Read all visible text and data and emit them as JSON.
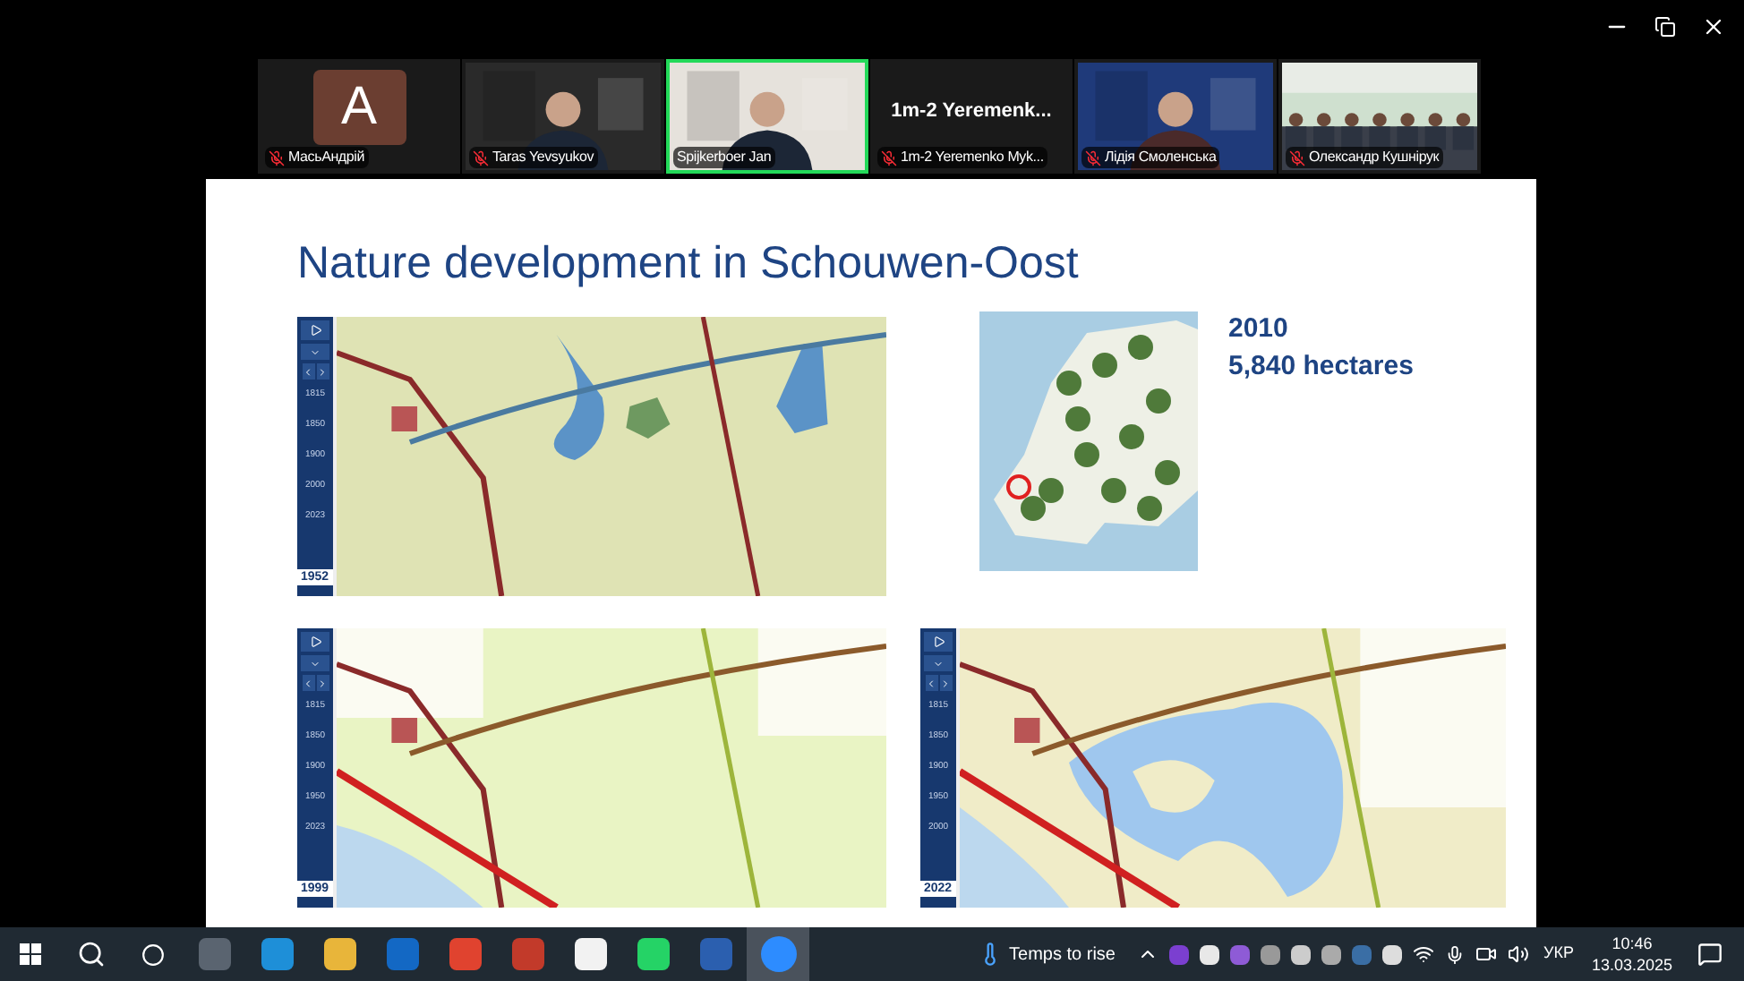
{
  "participants": [
    {
      "kind": "avatar",
      "initial": "A",
      "name": "МасьАндрій",
      "muted": true,
      "speaking": false
    },
    {
      "kind": "video",
      "name": "Taras Yevsyukov",
      "muted": true,
      "speaking": false
    },
    {
      "kind": "video",
      "name": "Spijkerboer Jan",
      "muted": false,
      "speaking": true
    },
    {
      "kind": "name",
      "display": "1m-2  Yeremenk...",
      "name": "1m-2 Yeremenko Myk...",
      "muted": true,
      "speaking": false
    },
    {
      "kind": "video",
      "name": "Лідія Смоленська",
      "muted": true,
      "speaking": false
    },
    {
      "kind": "video",
      "name": "Олександр Кушнірук",
      "muted": true,
      "speaking": false
    }
  ],
  "slide": {
    "title": "Nature development in Schouwen-Oost",
    "stats": [
      "2010",
      "5,840 hectares"
    ],
    "maps": [
      {
        "kind": "historic",
        "year": "1952",
        "ticks": [
          "1815",
          "1850",
          "1900",
          "2000",
          "2023"
        ]
      },
      {
        "kind": "topo",
        "year": "1999",
        "ticks": [
          "1815",
          "1850",
          "1900",
          "1950",
          "2023"
        ]
      },
      {
        "kind": "nature",
        "year": "2022",
        "ticks": [
          "1815",
          "1850",
          "1900",
          "1950",
          "2000"
        ]
      }
    ]
  },
  "taskbar": {
    "weather": "Temps to rise",
    "language": "УКР",
    "time": "10:46",
    "date": "13.03.2025"
  }
}
